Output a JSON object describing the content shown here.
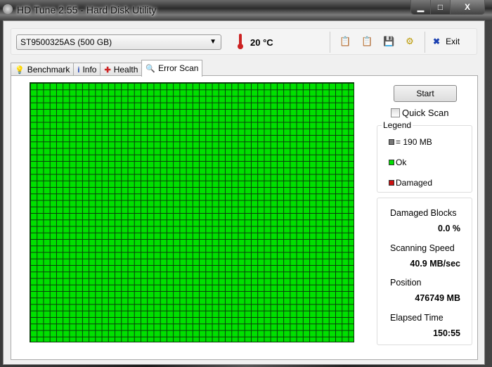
{
  "window": {
    "title": "HD Tune 2.55 - Hard Disk Utility",
    "min": "▁",
    "max": "□",
    "close": "X"
  },
  "toolbar": {
    "drive": "ST9500325AS (500 GB)",
    "temperature": "20 °C",
    "exit_label": "Exit"
  },
  "tabs": [
    {
      "label": "Benchmark"
    },
    {
      "label": "Info"
    },
    {
      "label": "Health"
    },
    {
      "label": "Error Scan"
    }
  ],
  "scan": {
    "start_label": "Start",
    "quick_scan_label": "Quick Scan",
    "quick_scan_checked": false,
    "block_status": "ok",
    "colors": {
      "ok": "#00e000",
      "damaged": "#cc1111",
      "block": "#777777"
    }
  },
  "legend": {
    "title": "Legend",
    "block_size": "= 190 MB",
    "ok": "Ok",
    "damaged": "Damaged"
  },
  "stats": {
    "damaged_blocks_label": "Damaged Blocks",
    "damaged_blocks": "0.0 %",
    "speed_label": "Scanning Speed",
    "speed": "40.9 MB/sec",
    "position_label": "Position",
    "position": "476749 MB",
    "elapsed_label": "Elapsed Time",
    "elapsed": "150:55"
  }
}
